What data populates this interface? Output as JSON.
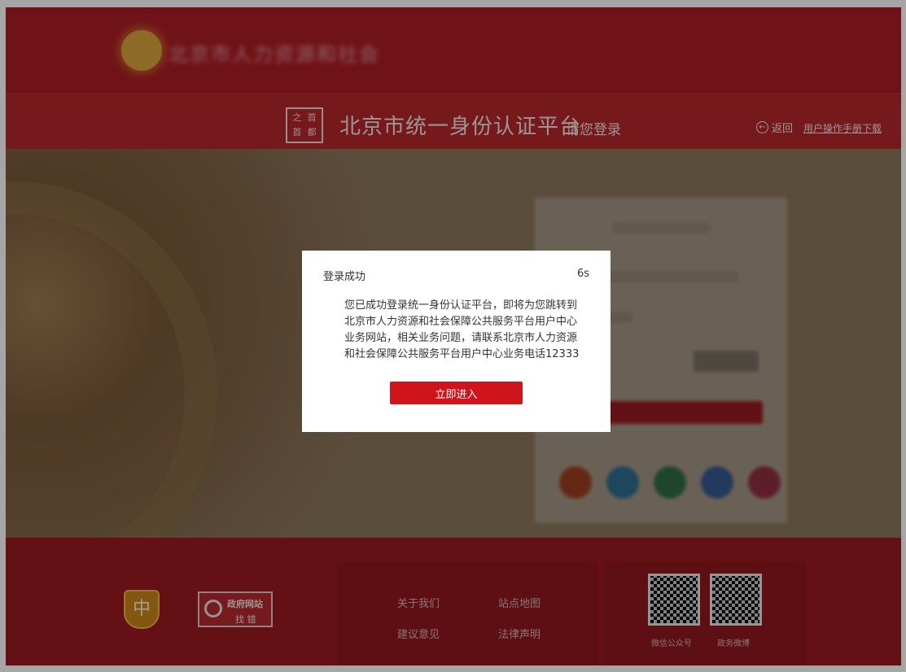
{
  "header": {
    "top_logo_text": "北京市人力资源和社会",
    "brand_logo_chars": [
      "之",
      "首",
      "首",
      "都"
    ],
    "title": "北京市统一身份认证平台",
    "subtitle": "请您登录",
    "back_label": "返回",
    "manual_label": "用户操作手册下载"
  },
  "footer": {
    "emblem_char": "中",
    "badge_line1": "政府网站",
    "badge_line2": "找 错",
    "links": [
      "关于我们",
      "站点地图",
      "建议意见",
      "法律声明"
    ],
    "qr_labels": [
      "微信公众号",
      "政务微博"
    ]
  },
  "dialog": {
    "title": "登录成功",
    "countdown": "6s",
    "message": "您已成功登录统一身份认证平台，即将为您跳转到北京市人力资源和社会保障公共服务平台用户中心业务网站，相关业务问题，请联系北京市人力资源和社会保障公共服务平台用户中心业务电话12333",
    "button_label": "立即进入",
    "accent_color": "#d0141c"
  }
}
